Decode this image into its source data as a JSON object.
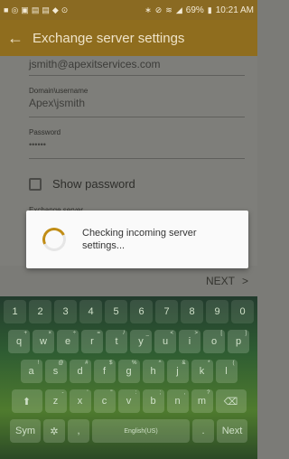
{
  "status": {
    "battery": "69%",
    "time": "10:21 AM"
  },
  "app_bar": {
    "title": "Exchange server settings"
  },
  "form": {
    "email_value": "jsmith@apexitservices.com",
    "domain_label": "Domain\\username",
    "domain_value": "Apex\\jsmith",
    "password_label": "Password",
    "password_value": "••••••",
    "show_password_label": "Show password",
    "exchange_label_partial": "Exchange server"
  },
  "dialog": {
    "message": "Checking incoming server settings..."
  },
  "next": {
    "label": "NEXT"
  },
  "keyboard": {
    "numbers": [
      "1",
      "2",
      "3",
      "4",
      "5",
      "6",
      "7",
      "8",
      "9",
      "0"
    ],
    "row1": [
      {
        "k": "q",
        "s": "+"
      },
      {
        "k": "w",
        "s": "×"
      },
      {
        "k": "e",
        "s": "÷"
      },
      {
        "k": "r",
        "s": "="
      },
      {
        "k": "t",
        "s": "/"
      },
      {
        "k": "y",
        "s": "_"
      },
      {
        "k": "u",
        "s": "<"
      },
      {
        "k": "i",
        "s": ">"
      },
      {
        "k": "o",
        "s": "["
      },
      {
        "k": "p",
        "s": "]"
      }
    ],
    "row2": [
      {
        "k": "a",
        "s": "!"
      },
      {
        "k": "s",
        "s": "@"
      },
      {
        "k": "d",
        "s": "#"
      },
      {
        "k": "f",
        "s": "$"
      },
      {
        "k": "g",
        "s": "%"
      },
      {
        "k": "h",
        "s": "^"
      },
      {
        "k": "j",
        "s": "&"
      },
      {
        "k": "k",
        "s": "*"
      },
      {
        "k": "l",
        "s": "("
      }
    ],
    "row3": [
      {
        "k": "z",
        "s": "-"
      },
      {
        "k": "x",
        "s": "'"
      },
      {
        "k": "c",
        "s": "\""
      },
      {
        "k": "v",
        "s": ":"
      },
      {
        "k": "b",
        "s": ";"
      },
      {
        "k": "n",
        "s": ","
      },
      {
        "k": "m",
        "s": "?"
      }
    ],
    "sym_label": "Sym",
    "comma_label": ",",
    "space_label": "English(US)",
    "period_label": ".",
    "next_key_label": "Next"
  },
  "colors": {
    "app_bar": "#8f6d1e",
    "status_bar": "#8a6a22",
    "spinner": "#c18d16"
  }
}
